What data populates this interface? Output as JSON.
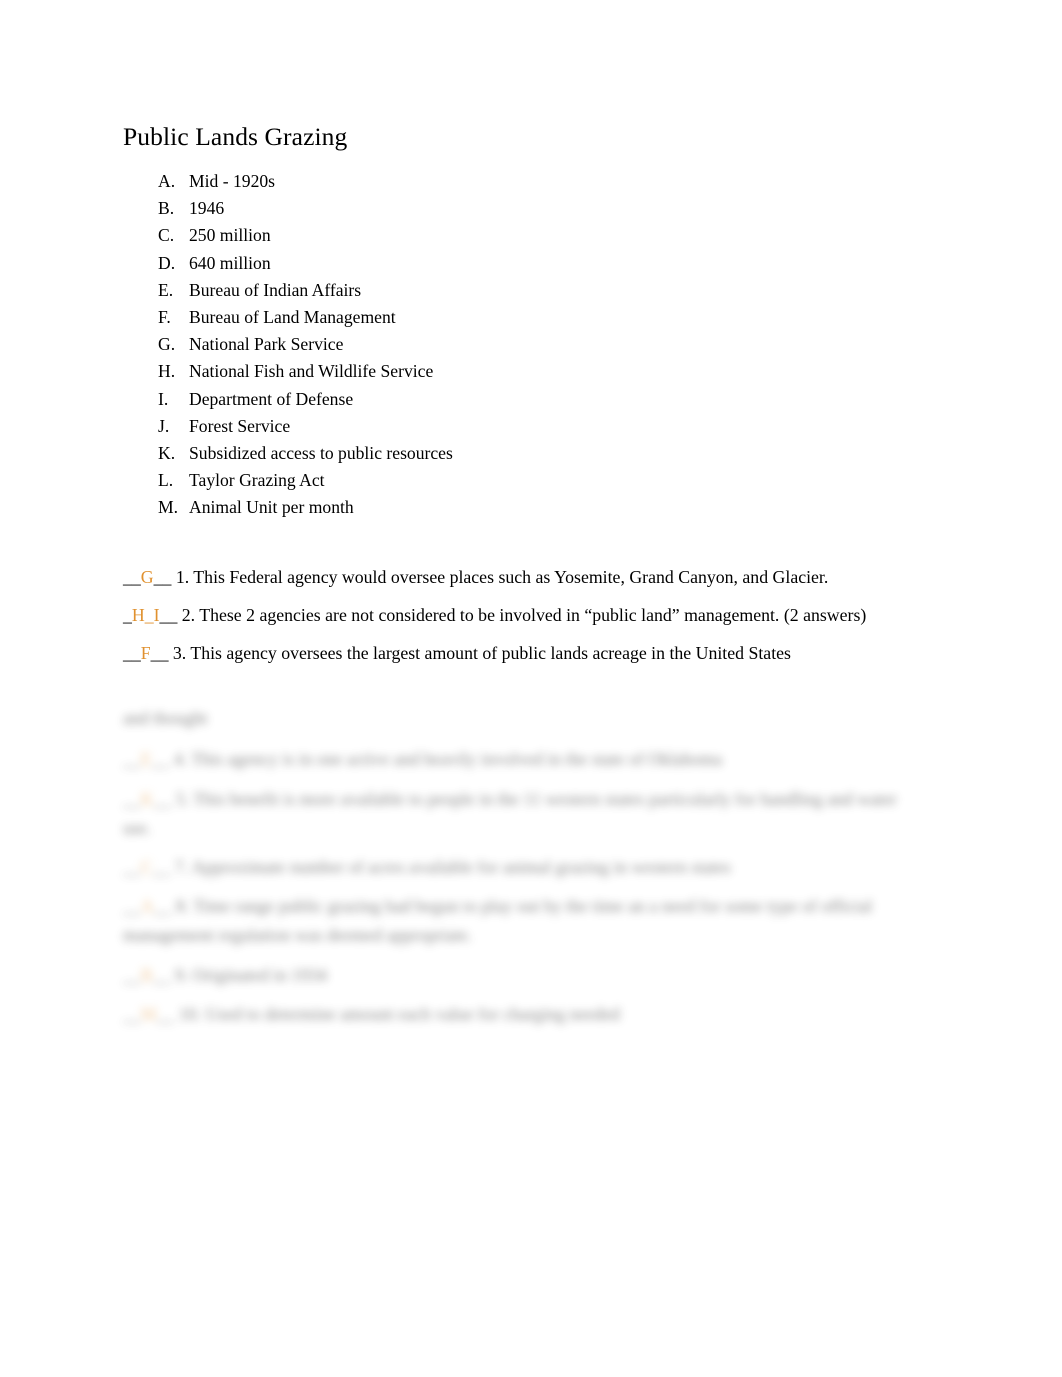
{
  "document": {
    "title": "Public Lands Grazing",
    "answer_color": "#E0912F",
    "text_color": "#000000"
  },
  "options": {
    "items": [
      {
        "marker": "A.",
        "text": "Mid - 1920s"
      },
      {
        "marker": "B.",
        "text": "1946"
      },
      {
        "marker": "C.",
        "text": "250 million"
      },
      {
        "marker": "D.",
        "text": "640 million"
      },
      {
        "marker": "E.",
        "text": "Bureau of Indian Affairs"
      },
      {
        "marker": "F.",
        "text": "Bureau of Land Management"
      },
      {
        "marker": "G.",
        "text": "National Park Service"
      },
      {
        "marker": "H.",
        "text": "National Fish and Wildlife Service"
      },
      {
        "marker": "I.",
        "text": "Department of Defense"
      },
      {
        "marker": "J.",
        "text": "Forest Service"
      },
      {
        "marker": "K.",
        "text": "Subsidized access to public resources"
      },
      {
        "marker": "L.",
        "text": "Taylor Grazing Act"
      },
      {
        "marker": "M.",
        "text": "Animal Unit per month"
      }
    ]
  },
  "questions": {
    "items": [
      {
        "blank_prefix": "__",
        "answer": "G",
        "blank_suffix": "__",
        "text": " 1. This Federal agency would oversee places such as Yosemite, Grand Canyon, and Glacier."
      },
      {
        "blank_prefix": "_",
        "answer": "H_I",
        "blank_suffix": "__",
        "text": " 2. These 2 agencies are not considered to be involved in “public land” management. (2 answers)"
      },
      {
        "blank_prefix": "__",
        "answer": "F",
        "blank_suffix": "__",
        "text": " 3.  This agency oversees the largest amount of public lands acreage in the United States"
      }
    ]
  },
  "obscured_section": {
    "heading": "and thought",
    "items": [
      {
        "blank_prefix": "__",
        "answer": "E",
        "blank_suffix": "__",
        "text": " 4.  This agency is in one active and heavily involved in the state of Oklahoma"
      },
      {
        "blank_prefix": "__",
        "answer": "K",
        "blank_suffix": "__",
        "text": " 5.  This benefit is more available to people in the 11 western states particularly for handling and water use."
      },
      {
        "blank_prefix": "__",
        "answer": "C",
        "blank_suffix": "__",
        "text": " 7.  Approximate number of acres available for animal grazing in western states"
      },
      {
        "blank_prefix": "__",
        "answer": "A",
        "blank_suffix": "__",
        "text": " 8.  Time range public grazing had begun to play out by the time an a need for some type of official management regulation was deemed appropriate."
      },
      {
        "blank_prefix": "__",
        "answer": "B",
        "blank_suffix": "__",
        "text": " 9.  Originated in 1934"
      },
      {
        "blank_prefix": "__",
        "answer": "M",
        "blank_suffix": "__",
        "text": " 10. Used to determine amount each value for charging needed"
      }
    ]
  }
}
